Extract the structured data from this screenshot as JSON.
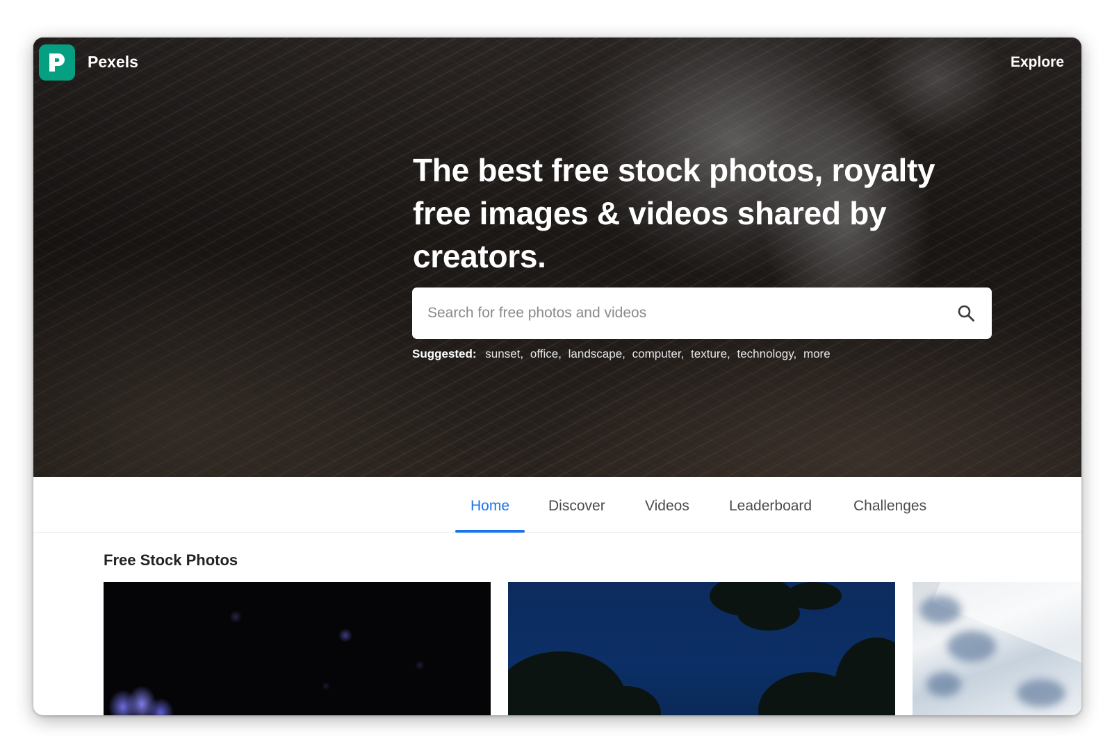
{
  "header": {
    "brand": "Pexels",
    "explore_label": "Explore"
  },
  "hero": {
    "headline": "The best free stock photos, royalty free images & videos shared by creators.",
    "search": {
      "placeholder": "Search for free photos and videos",
      "value": ""
    },
    "suggested": {
      "label": "Suggested:",
      "tags": [
        "sunset",
        "office",
        "landscape",
        "computer",
        "texture",
        "technology",
        "more"
      ]
    }
  },
  "nav": {
    "tabs": [
      {
        "label": "Home",
        "active": true
      },
      {
        "label": "Discover",
        "active": false
      },
      {
        "label": "Videos",
        "active": false
      },
      {
        "label": "Leaderboard",
        "active": false
      },
      {
        "label": "Challenges",
        "active": false
      }
    ]
  },
  "content": {
    "section_title": "Free Stock Photos"
  },
  "colors": {
    "brand": "#05a081",
    "active_tab": "#1a73e8"
  },
  "icons": {
    "logo": "pexels-logo-icon",
    "search": "search-icon"
  }
}
